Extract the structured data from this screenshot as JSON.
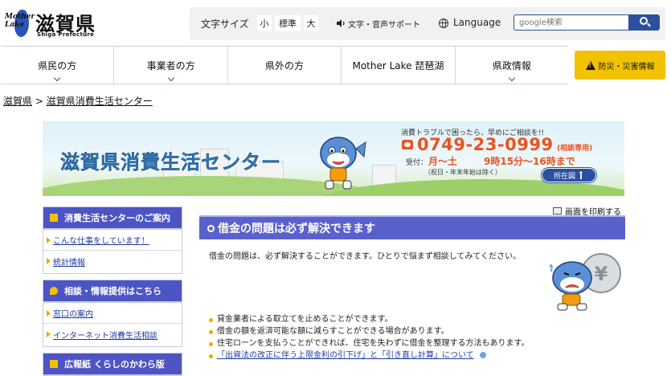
{
  "header": {
    "logo_mark_text": "Mother Lake",
    "logo_title": "滋賀県",
    "logo_subtitle": "Shiga Prefecture"
  },
  "utility": {
    "font_size_label": "文字サイズ",
    "font_small": "小",
    "font_standard": "標準",
    "font_large": "大",
    "voice_support": "文字・音声サポート",
    "language": "Language",
    "search_placeholder": "google検索"
  },
  "nav": {
    "items": [
      "県民の方",
      "事業者の方",
      "県外の方",
      "Mother Lake 琵琶湖",
      "県政情報"
    ],
    "disaster": "防災・災害情報"
  },
  "breadcrumb": {
    "home": "滋賀県",
    "separator": ">",
    "current": "滋賀県消費生活センター"
  },
  "banner": {
    "title": "滋賀県消費生活センター",
    "message": "消費トラブルで困ったら、早めにご相談を!!",
    "phone": "0749-23-0999",
    "phone_tag": "(相談専用)",
    "hours_label": "受付：",
    "hours_days": "月～土",
    "hours_time": "9時15分～16時まで",
    "hours_note": "（祝日・年末年始は除く）",
    "map_button": "所在図"
  },
  "sidebar": {
    "sections": [
      {
        "title": "消費生活センターのご案内",
        "items": [
          "こんな仕事をしています！",
          "統計情報"
        ]
      },
      {
        "title": "相談・情報提供はこちら",
        "items": [
          "窓口の案内",
          "インターネット消費生活相談"
        ]
      },
      {
        "title": "広報紙 くらしのかわら版",
        "items": []
      }
    ]
  },
  "main": {
    "print_label": "画面を印刷する",
    "heading": "借金の問題は必ず解決できます",
    "intro": "借金の問題は、必ず解決することができます。ひとりで悩まず相談してみてください。",
    "bullets": [
      "貸金業者による取立てを止めることができます。",
      "借金の額を返済可能な額に減らすことができる場合があります。",
      "住宅ローンを支払うことができれば、住宅を失わずに借金を整理する方法もあります。"
    ],
    "link_bullet": "「出資法の改正に伴う上限金利の引下げ」と「引き直し計算」について"
  },
  "colors": {
    "accent_blue": "#2c4f9e",
    "heading_purple": "#5b61cc",
    "sidebar_head": "#4d55c4",
    "disaster_yellow": "#f2c200",
    "phone_orange": "#e8541f"
  }
}
